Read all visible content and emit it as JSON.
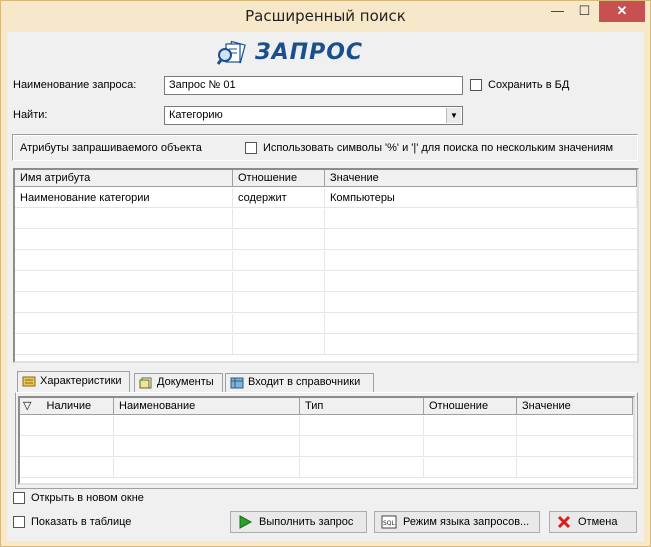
{
  "window": {
    "title": "Расширенный поиск",
    "minimize_glyph": "—",
    "maximize_glyph": "☐",
    "close_glyph": "✕"
  },
  "logo": {
    "text": "ЗАПРОС",
    "icon": "magnifier-docs-icon"
  },
  "query": {
    "name_label": "Наименование запроса:",
    "name_value": "Запрос № 01",
    "save_to_db_label": "Сохранить в БД",
    "save_to_db_checked": false,
    "find_label": "Найти:",
    "find_value": "Категорию"
  },
  "attributes": {
    "group_label": "Атрибуты запрашиваемого объекта",
    "wildcard_label": "Использовать символы '%' и '|' для поиска по нескольким значениям",
    "wildcard_checked": false,
    "columns": [
      "Имя атрибута",
      "Отношение",
      "Значение"
    ],
    "rows": [
      [
        "Наименование категории",
        "содержит",
        "Компьютеры"
      ]
    ]
  },
  "tabs": [
    {
      "label": "Характеристики",
      "icon": "characteristics-icon",
      "active": true
    },
    {
      "label": "Документы",
      "icon": "documents-icon",
      "active": false
    },
    {
      "label": "Входит в справочники",
      "icon": "catalogs-icon",
      "active": false
    }
  ],
  "characteristics": {
    "columns": [
      "Наличие",
      "Наименование",
      "Тип",
      "Отношение",
      "Значение"
    ],
    "sort_indicator": "▽"
  },
  "options": {
    "open_new_window_label": "Открыть в новом окне",
    "open_new_window_checked": false,
    "show_in_table_label": "Показать в таблице",
    "show_in_table_checked": false
  },
  "buttons": {
    "run": "Выполнить запрос",
    "query_mode": "Режим языка запросов...",
    "cancel": "Отмена"
  },
  "colors": {
    "accent": "#1a4f8f",
    "frame": "#f6e8c9",
    "run_icon": "#2aa12a",
    "cancel_icon": "#d42020"
  }
}
